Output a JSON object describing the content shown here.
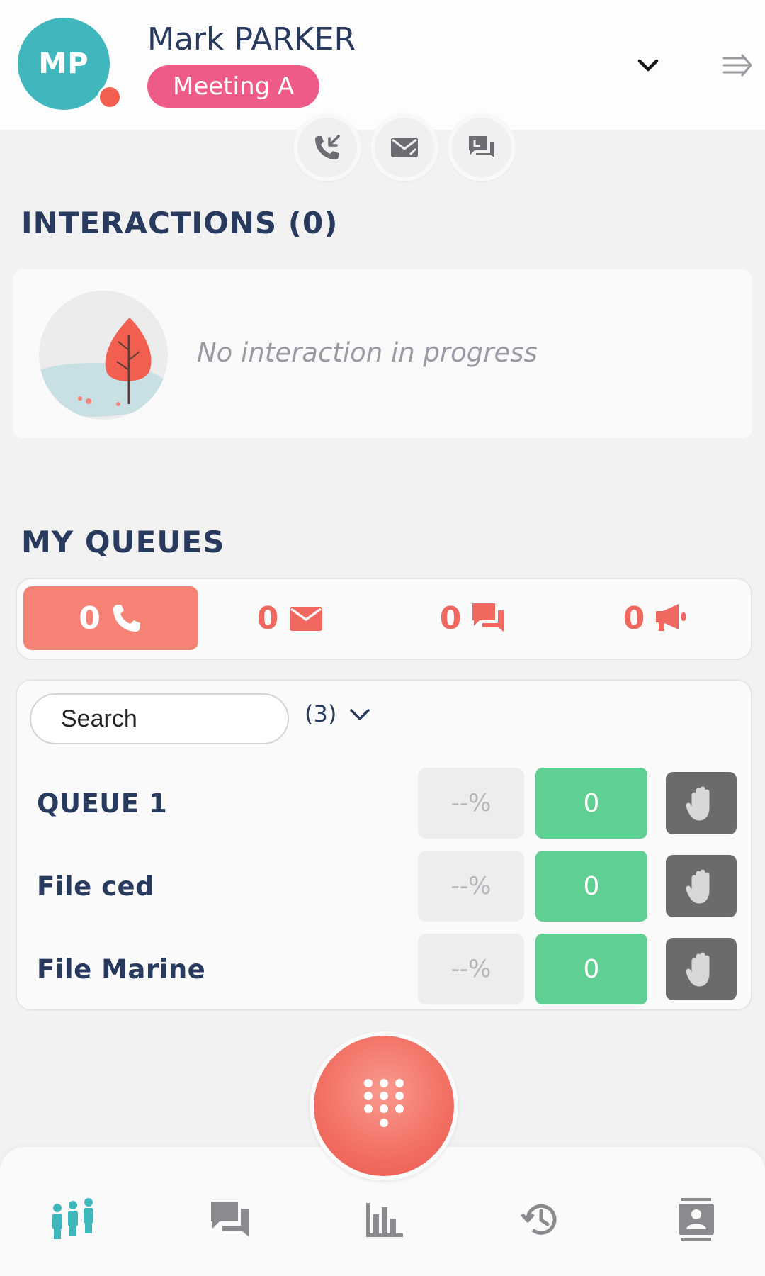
{
  "header": {
    "avatar_initials": "MP",
    "user_name": "Mark PARKER",
    "status": "Meeting A",
    "status_color": "#ee5b87",
    "presence_color": "#f25e50",
    "shortcuts": [
      "phone-incoming-icon",
      "mail-icon",
      "chat-icon"
    ]
  },
  "interactions": {
    "title": "INTERACTIONS (0)",
    "empty_text": "No interaction in progress"
  },
  "queues": {
    "title": "MY QUEUES",
    "channels": [
      {
        "count": "0",
        "icon": "phone-icon",
        "active": true
      },
      {
        "count": "0",
        "icon": "mail-icon",
        "active": false
      },
      {
        "count": "0",
        "icon": "chat-icon",
        "active": false
      },
      {
        "count": "0",
        "icon": "megaphone-icon",
        "active": false
      }
    ],
    "search": {
      "placeholder": "Search"
    },
    "count_label": "(3)",
    "list": [
      {
        "name": "QUEUE 1",
        "percent": "--%",
        "waiting": "0"
      },
      {
        "name": "File ced",
        "percent": "--%",
        "waiting": "0"
      },
      {
        "name": "File Marine",
        "percent": "--%",
        "waiting": "0"
      }
    ]
  },
  "bottom_nav": [
    "team-icon",
    "chat-icon",
    "stats-icon",
    "history-icon",
    "contacts-icon"
  ],
  "colors": {
    "accent": "#3fb7bd",
    "coral": "#f58275",
    "green": "#5fcf93",
    "navy": "#283a5e"
  }
}
